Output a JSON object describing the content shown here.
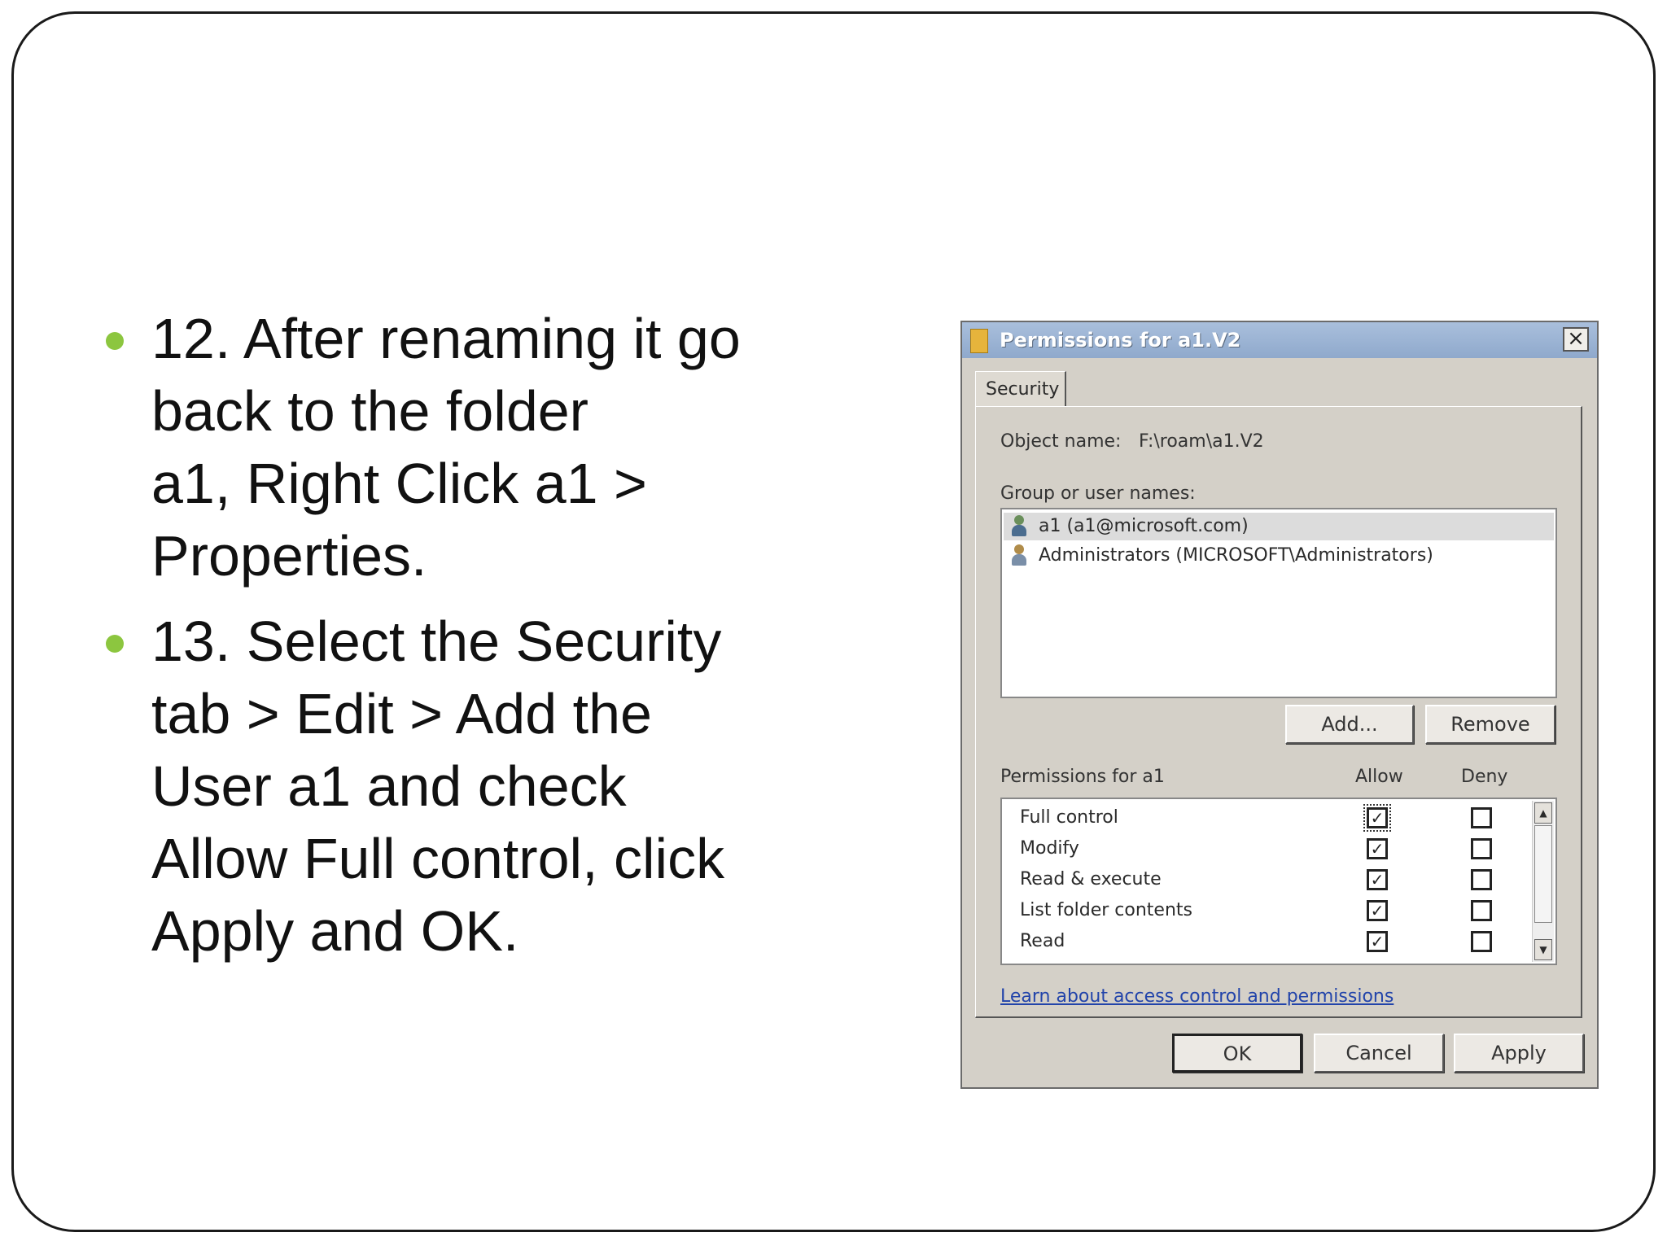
{
  "slide": {
    "bullets": [
      {
        "lines": [
          "12. After renaming it go",
          "back to the folder",
          "a1, Right Click a1 >",
          "Properties."
        ]
      },
      {
        "lines": [
          "13. Select the Security",
          "tab  > Edit  > Add the",
          "User a1 and check",
          "Allow Full control, click",
          "Apply and OK."
        ]
      }
    ],
    "bullet_color": "#8cc63f"
  },
  "dialog": {
    "title": "Permissions for a1.V2",
    "close_label": "×",
    "tab_label": "Security",
    "object_name_label": "Object name:",
    "object_name_value": "F:\\roam\\a1.V2",
    "group_label": "Group or user names:",
    "users": [
      {
        "name": "a1 (a1@microsoft.com)",
        "icon": "user-icon",
        "selected": true
      },
      {
        "name": "Administrators (MICROSOFT\\Administrators)",
        "icon": "group-icon",
        "selected": false
      }
    ],
    "add_button": "Add...",
    "remove_button": "Remove",
    "permissions_label": "Permissions for a1",
    "allow_header": "Allow",
    "deny_header": "Deny",
    "permissions": [
      {
        "name": "Full control",
        "allow": true,
        "deny": false
      },
      {
        "name": "Modify",
        "allow": true,
        "deny": false
      },
      {
        "name": "Read & execute",
        "allow": true,
        "deny": false
      },
      {
        "name": "List folder contents",
        "allow": true,
        "deny": false
      },
      {
        "name": "Read",
        "allow": true,
        "deny": false
      }
    ],
    "learn_link": "Learn about access control and permissions",
    "ok_button": "OK",
    "cancel_button": "Cancel",
    "apply_button": "Apply",
    "check_mark": "✓",
    "scroll_up": "▲",
    "scroll_down": "▼"
  }
}
